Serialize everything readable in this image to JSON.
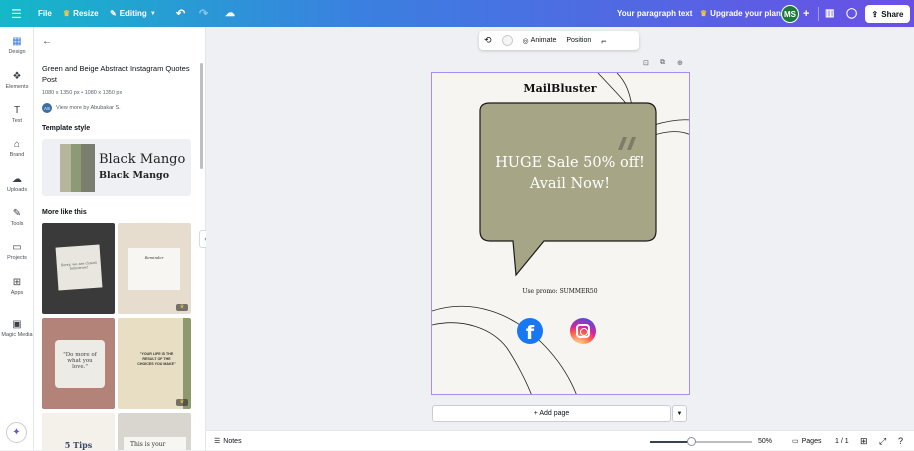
{
  "topbar": {
    "file_label": "File",
    "resize_label": "Resize",
    "editing_label": "Editing",
    "doc_title": "Your paragraph text",
    "upgrade_label": "Upgrade your plan",
    "avatar_initials": "MS",
    "share_label": "Share"
  },
  "rail": {
    "items": [
      {
        "label": "Design",
        "icon": "design-icon"
      },
      {
        "label": "Elements",
        "icon": "elements-icon"
      },
      {
        "label": "Text",
        "icon": "text-icon"
      },
      {
        "label": "Brand",
        "icon": "brand-icon"
      },
      {
        "label": "Uploads",
        "icon": "uploads-icon"
      },
      {
        "label": "Tools",
        "icon": "tools-icon"
      },
      {
        "label": "Projects",
        "icon": "projects-icon"
      },
      {
        "label": "Apps",
        "icon": "apps-icon"
      },
      {
        "label": "Magic Media",
        "icon": "magic-media-icon"
      }
    ]
  },
  "panel": {
    "template_title": "Green and Beige Abstract Instagram Quotes Post",
    "template_size": "1080 x 1350 px • 1080 x 1350 px",
    "author_initials": "AS",
    "author_label": "View more by Abubakar S.",
    "template_style_heading": "Template style",
    "style_text_large": "Black Mango",
    "style_text_small": "Black Mango",
    "more_like_heading": "More like this",
    "thumbs": [
      {
        "text": "Sorry, we are closed tomorrow!"
      },
      {
        "text": "Reminder"
      },
      {
        "text": "\"Do more of what you love.\""
      },
      {
        "text": "\"YOUR LIFE IS THE RESULT OF THE CHOICES YOU MAKE\""
      },
      {
        "text": "5 Tips"
      },
      {
        "text": "This is your"
      }
    ]
  },
  "float_toolbar": {
    "animate_label": "Animate",
    "position_label": "Position"
  },
  "design": {
    "brand": "MailBluster",
    "headline": "HUGE Sale 50% off! Avail Now!",
    "promo": "Use promo: SUMMER50",
    "fb_glyph": "f",
    "bubble_color": "#a6a686",
    "accent_color": "#a98ef0"
  },
  "canvas": {
    "add_page_label": "+ Add page"
  },
  "bottombar": {
    "notes_label": "Notes",
    "zoom_value": 50,
    "zoom_label": "50%",
    "pages_label": "Pages",
    "page_count": "1 / 1"
  }
}
